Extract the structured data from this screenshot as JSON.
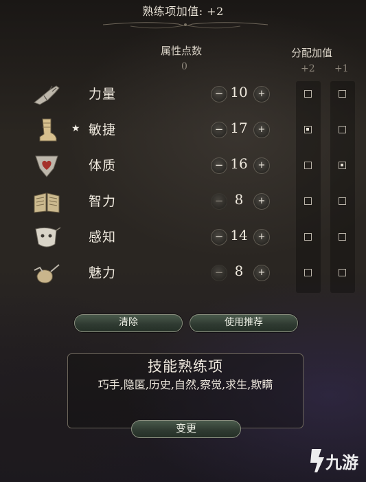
{
  "header": {
    "title": "熟练项加值: +2"
  },
  "columns": {
    "points_label": "属性点数",
    "points_remaining": "0",
    "bonus_label": "分配加值",
    "bonus_plus2": "+2",
    "bonus_plus1": "+1"
  },
  "attributes": [
    {
      "name": "力量",
      "value": "10",
      "starred": false,
      "minus_enabled": true,
      "plus_enabled": true,
      "bonus2": false,
      "bonus1": false,
      "icon": "gauntlet-icon"
    },
    {
      "name": "敏捷",
      "value": "17",
      "starred": true,
      "star": "★",
      "minus_enabled": true,
      "plus_enabled": true,
      "bonus2": true,
      "bonus1": false,
      "icon": "boot-icon"
    },
    {
      "name": "体质",
      "value": "16",
      "starred": false,
      "minus_enabled": true,
      "plus_enabled": true,
      "bonus2": false,
      "bonus1": true,
      "icon": "heart-shield-icon"
    },
    {
      "name": "智力",
      "value": "8",
      "starred": false,
      "minus_enabled": false,
      "plus_enabled": true,
      "bonus2": false,
      "bonus1": false,
      "icon": "open-book-icon"
    },
    {
      "name": "感知",
      "value": "14",
      "starred": false,
      "minus_enabled": true,
      "plus_enabled": true,
      "bonus2": false,
      "bonus1": false,
      "icon": "eye-mask-icon"
    },
    {
      "name": "魅力",
      "value": "8",
      "starred": false,
      "minus_enabled": false,
      "plus_enabled": true,
      "bonus2": false,
      "bonus1": false,
      "icon": "lute-hand-icon"
    }
  ],
  "buttons": {
    "clear": "清除",
    "recommend": "使用推荐",
    "change": "变更"
  },
  "skills": {
    "title": "技能熟练项",
    "list": "巧手,隐匿,历史,自然,察觉,求生,欺瞒"
  },
  "watermark": {
    "text": "九游",
    "icon": "jiuyou-logo-icon"
  },
  "colors": {
    "text": "#efe9de",
    "button_green": "#303b32",
    "button_border": "#8a8f7f"
  }
}
